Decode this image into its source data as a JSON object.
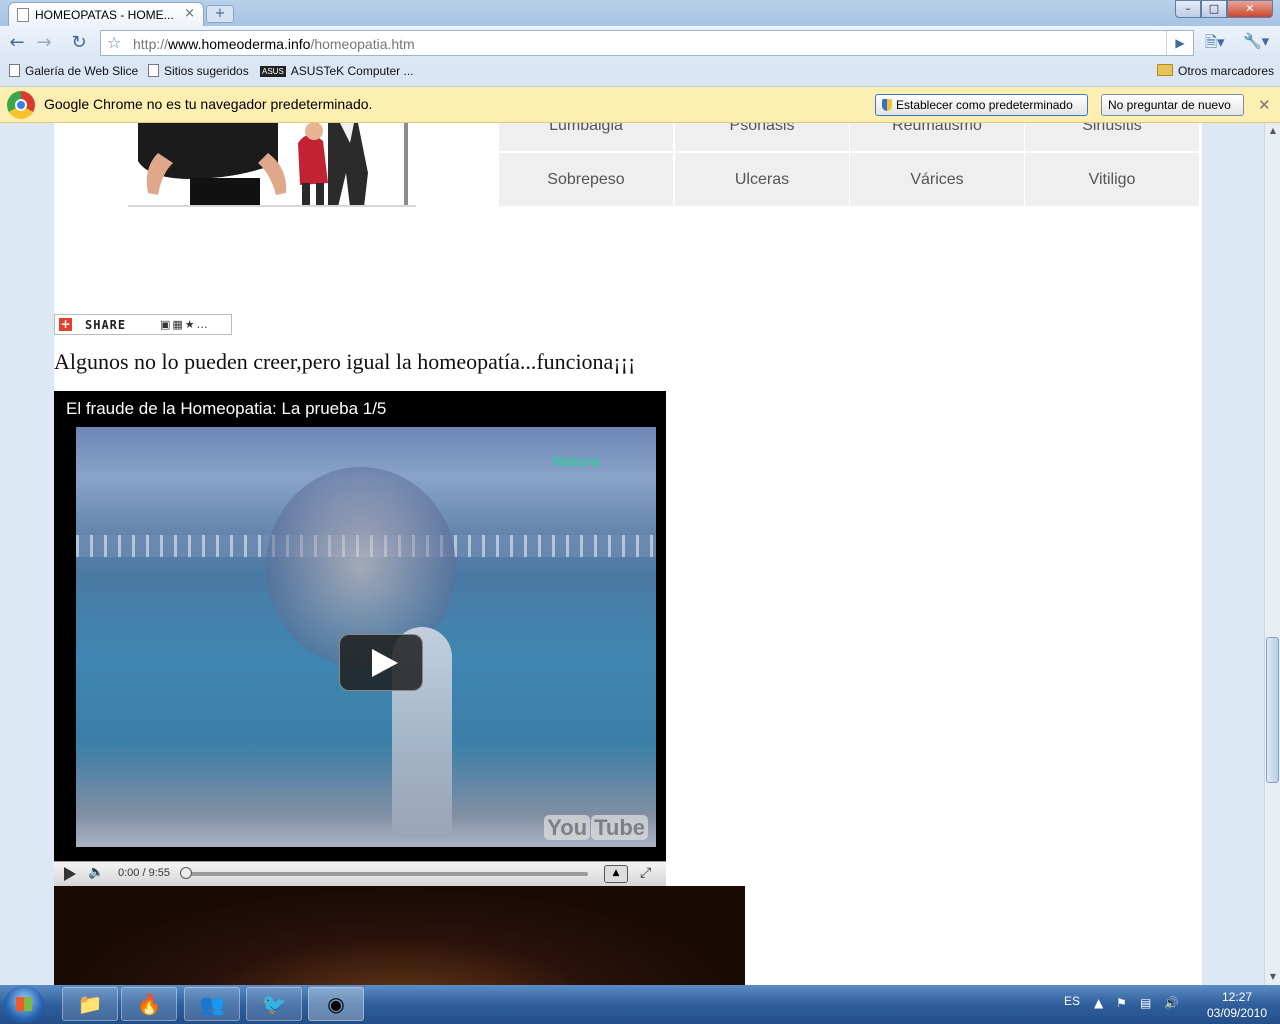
{
  "browser": {
    "tab_title": "HOMEOPATAS - HOME...",
    "tab_close": "×",
    "new_tab": "+",
    "window": {
      "minimize": "–",
      "maximize": "□",
      "close": "✕"
    },
    "url_prefix": "http://",
    "url_host": "www.homeoderma.info",
    "url_path": "/homeopatia.htm",
    "bookmarks": [
      "Galería de Web Slice",
      "Sitios sugeridos",
      "ASUSTeK Computer ..."
    ],
    "other_bookmarks": "Otros marcadores",
    "asus_badge": "ASUS"
  },
  "infobar": {
    "message": "Google Chrome no es tu navegador predeterminado.",
    "set_default": "Establecer como predeterminado",
    "dont_ask": "No preguntar de nuevo",
    "close": "✕"
  },
  "page": {
    "grid_row1": [
      "Lumbalgia",
      "Psoriasis",
      "Reumatismo",
      "Sinusitis"
    ],
    "grid_row2": [
      "Sobrepeso",
      "Ulceras",
      "Várices",
      "Vitiligo"
    ],
    "share_label": "SHARE",
    "headline": "Algunos no lo pueden creer,pero igual la homeopatía...funciona¡¡¡",
    "video": {
      "title": "El fraude de la Homeopatia: La prueba 1/5",
      "watermark": "Natura",
      "logo_you": "You",
      "logo_tube": "Tube",
      "time": "0:00 / 9:55",
      "progress": 0.0
    }
  },
  "taskbar": {
    "lang": "ES",
    "time": "12:27",
    "date": "03/09/2010"
  }
}
